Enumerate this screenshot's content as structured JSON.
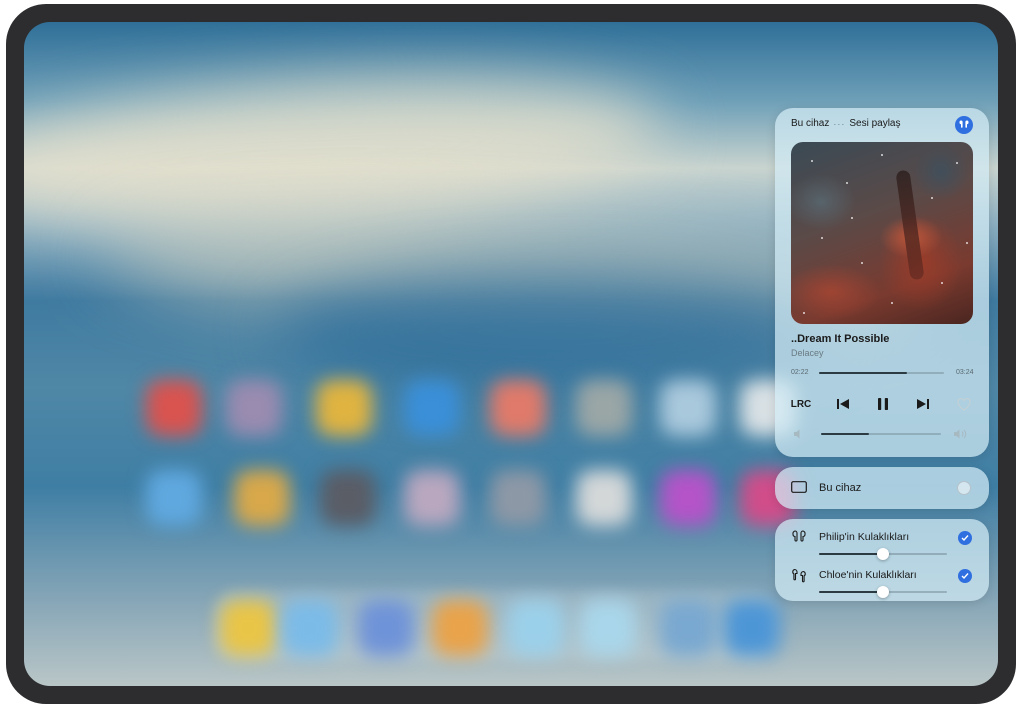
{
  "player": {
    "source_label": "Bu cihaz",
    "separator": "···",
    "share_label": "Sesi paylaş",
    "share_icon": "earbuds-icon",
    "song_title": "..Dream It Possible",
    "artist": "Delacey",
    "elapsed": "02:22",
    "total": "03:24",
    "progress_fraction": 0.7,
    "lyrics_label": "LRC",
    "volume_fraction": 0.4
  },
  "output_device": {
    "label": "Bu cihaz",
    "selected": false
  },
  "headphones": [
    {
      "label": "Philip'in Kulaklıkları",
      "checked": true,
      "volume_fraction": 0.5
    },
    {
      "label": "Chloe'nin Kulaklıkları",
      "checked": true,
      "volume_fraction": 0.5
    }
  ],
  "colors": {
    "accent": "#2f6fe0",
    "panel": "#d2ebf5"
  }
}
